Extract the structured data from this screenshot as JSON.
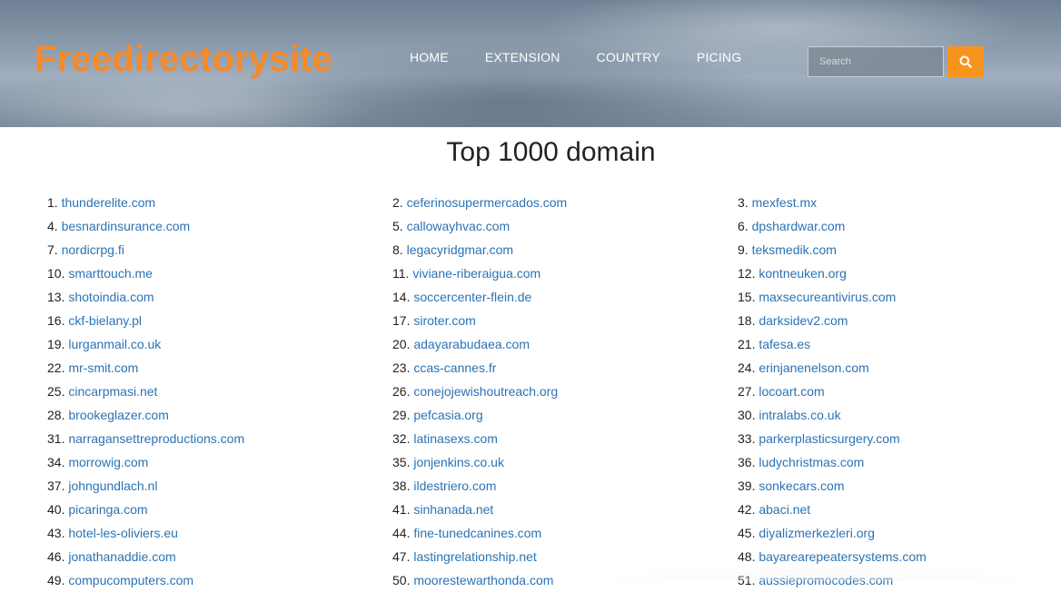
{
  "header": {
    "logo": "Freedirectorysite",
    "nav": [
      "HOME",
      "EXTENSION",
      "COUNTRY",
      "PICING"
    ],
    "search_placeholder": "Search",
    "search_icon": "search-icon",
    "accent_color": "#f58a2a",
    "button_color": "#f7941d"
  },
  "main": {
    "title": "Top 1000 domain",
    "link_color": "#2a73b5",
    "domains": [
      {
        "num": "1.",
        "name": "thunderelite.com"
      },
      {
        "num": "2.",
        "name": "ceferinosupermercados.com"
      },
      {
        "num": "3.",
        "name": "mexfest.mx"
      },
      {
        "num": "4.",
        "name": "besnardinsurance.com"
      },
      {
        "num": "5.",
        "name": "callowayhvac.com"
      },
      {
        "num": "6.",
        "name": "dpshardwar.com"
      },
      {
        "num": "7.",
        "name": "nordicrpg.fi"
      },
      {
        "num": "8.",
        "name": "legacyridgmar.com"
      },
      {
        "num": "9.",
        "name": "teksmedik.com"
      },
      {
        "num": "10.",
        "name": "smarttouch.me"
      },
      {
        "num": "11.",
        "name": "viviane-riberaigua.com"
      },
      {
        "num": "12.",
        "name": "kontneuken.org"
      },
      {
        "num": "13.",
        "name": "shotoindia.com"
      },
      {
        "num": "14.",
        "name": "soccercenter-flein.de"
      },
      {
        "num": "15.",
        "name": "maxsecureantivirus.com"
      },
      {
        "num": "16.",
        "name": "ckf-bielany.pl"
      },
      {
        "num": "17.",
        "name": "siroter.com"
      },
      {
        "num": "18.",
        "name": "darksidev2.com"
      },
      {
        "num": "19.",
        "name": "lurganmail.co.uk"
      },
      {
        "num": "20.",
        "name": "adayarabudaea.com"
      },
      {
        "num": "21.",
        "name": "tafesa.es"
      },
      {
        "num": "22.",
        "name": "mr-smit.com"
      },
      {
        "num": "23.",
        "name": "ccas-cannes.fr"
      },
      {
        "num": "24.",
        "name": "erinjanenelson.com"
      },
      {
        "num": "25.",
        "name": "cincarpmasi.net"
      },
      {
        "num": "26.",
        "name": "conejojewishoutreach.org"
      },
      {
        "num": "27.",
        "name": "locoart.com"
      },
      {
        "num": "28.",
        "name": "brookeglazer.com"
      },
      {
        "num": "29.",
        "name": "pefcasia.org"
      },
      {
        "num": "30.",
        "name": "intralabs.co.uk"
      },
      {
        "num": "31.",
        "name": "narragansettreproductions.com"
      },
      {
        "num": "32.",
        "name": "latinasexs.com"
      },
      {
        "num": "33.",
        "name": "parkerplasticsurgery.com"
      },
      {
        "num": "34.",
        "name": "morrowig.com"
      },
      {
        "num": "35.",
        "name": "jonjenkins.co.uk"
      },
      {
        "num": "36.",
        "name": "ludychristmas.com"
      },
      {
        "num": "37.",
        "name": "johngundlach.nl"
      },
      {
        "num": "38.",
        "name": "ildestriero.com"
      },
      {
        "num": "39.",
        "name": "sonkecars.com"
      },
      {
        "num": "40.",
        "name": "picaringa.com"
      },
      {
        "num": "41.",
        "name": "sinhanada.net"
      },
      {
        "num": "42.",
        "name": "abaci.net"
      },
      {
        "num": "43.",
        "name": "hotel-les-oliviers.eu"
      },
      {
        "num": "44.",
        "name": "fine-tunedcanines.com"
      },
      {
        "num": "45.",
        "name": "diyalizmerkezleri.org"
      },
      {
        "num": "46.",
        "name": "jonathanaddie.com"
      },
      {
        "num": "47.",
        "name": "lastingrelationship.net"
      },
      {
        "num": "48.",
        "name": "bayarearepeatersystems.com"
      },
      {
        "num": "49.",
        "name": "compucomputers.com"
      },
      {
        "num": "50.",
        "name": "moorestewarthonda.com"
      },
      {
        "num": "51.",
        "name": "aussiepromocodes.com"
      }
    ]
  }
}
